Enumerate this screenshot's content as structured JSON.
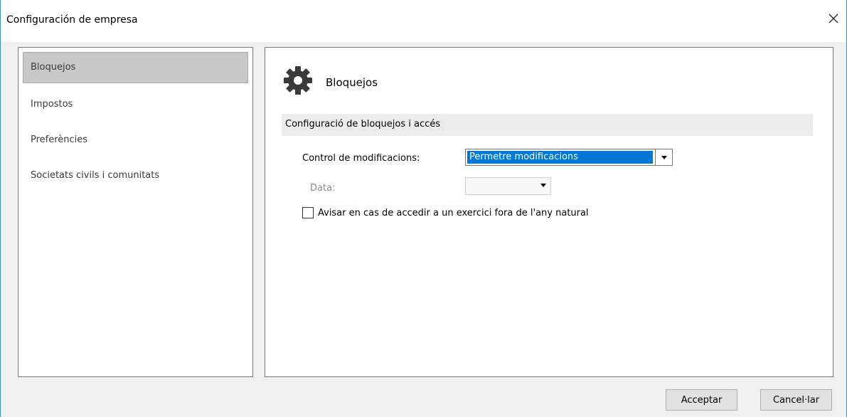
{
  "window": {
    "title": "Configuración de empresa",
    "accent_color": "#3c8cd7"
  },
  "nav": {
    "items": [
      {
        "label": "Bloquejos",
        "selected": true
      },
      {
        "label": "Impostos",
        "selected": false
      },
      {
        "label": "Preferències",
        "selected": false
      },
      {
        "label": "Societats civils i comunitats",
        "selected": false
      }
    ]
  },
  "content": {
    "heading": "Bloquejos",
    "heading_icon": "gear-icon",
    "section_title": "Configuració de bloquejos i accés",
    "control_label": "Control de modificacions:",
    "control_value": "Permetre modificacions",
    "date_label": "Data:",
    "date_value": "",
    "checkbox_label": "Avisar en cas de accedir a un exercici fora de l'any natural",
    "checkbox_checked": false,
    "selection_color": "#0078d7"
  },
  "buttons": {
    "ok_label": "Acceptar",
    "cancel_label": "Cancel·lar"
  }
}
